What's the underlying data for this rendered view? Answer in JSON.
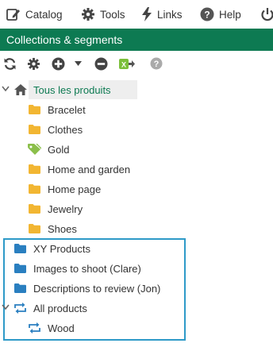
{
  "menubar": {
    "catalog_label": "Catalog",
    "tools_label": "Tools",
    "links_label": "Links",
    "help_label": "Help"
  },
  "panel": {
    "title": "Collections & segments"
  },
  "tree": {
    "root_label": "Tous les produits",
    "categories": [
      {
        "label": "Bracelet",
        "icon": "folder-icon"
      },
      {
        "label": "Clothes",
        "icon": "folder-icon"
      },
      {
        "label": "Gold",
        "icon": "tag-icon"
      },
      {
        "label": "Home and garden",
        "icon": "folder-icon"
      },
      {
        "label": "Home page",
        "icon": "folder-icon"
      },
      {
        "label": "Jewelry",
        "icon": "folder-icon"
      },
      {
        "label": "Shoes",
        "icon": "folder-icon"
      }
    ],
    "segments": [
      {
        "label": "XY Products",
        "icon": "folder-icon"
      },
      {
        "label": "Images to shoot (Clare)",
        "icon": "folder-icon"
      },
      {
        "label": "Descriptions to review (Jon)",
        "icon": "folder-icon"
      },
      {
        "label": "All products",
        "icon": "sync-icon"
      },
      {
        "label": "Wood",
        "icon": "sync-icon"
      }
    ]
  },
  "colors": {
    "header_bg": "#0d7a52",
    "root_text": "#0d7a52",
    "folder_yellow": "#f2b632",
    "segment_blue": "#2a7fc0",
    "highlight_border": "#2e9ac8",
    "tag_green": "#8bbf4a"
  }
}
